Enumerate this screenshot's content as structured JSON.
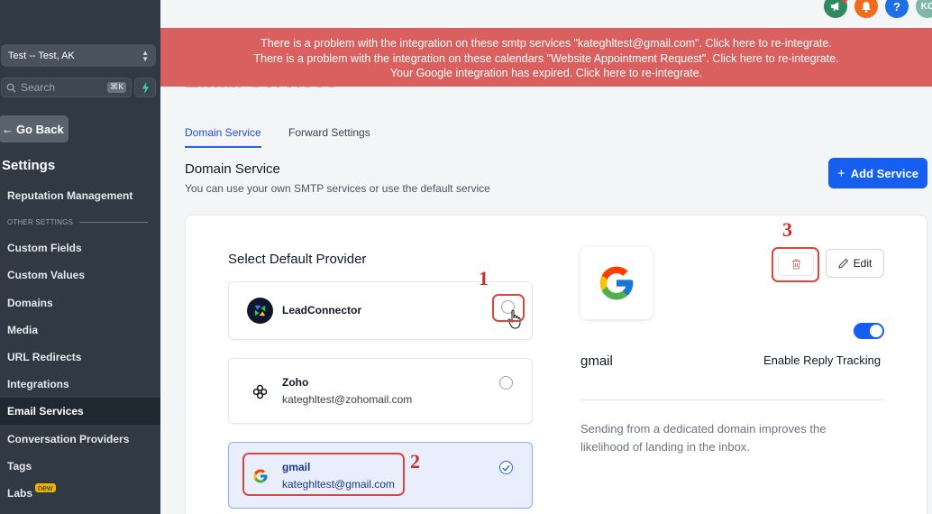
{
  "sidebar": {
    "location": "Test -- Test, AK",
    "search_placeholder": "Search",
    "search_shortcut": "⌘K",
    "back_label": "Go Back",
    "title": "Settings",
    "section_label": "OTHER SETTINGS",
    "items": [
      {
        "label": "Reputation Management"
      },
      {
        "label": "Custom Fields"
      },
      {
        "label": "Custom Values"
      },
      {
        "label": "Domains"
      },
      {
        "label": "Media"
      },
      {
        "label": "URL Redirects"
      },
      {
        "label": "Integrations"
      },
      {
        "label": "Email Services",
        "active": true
      },
      {
        "label": "Conversation Providers"
      },
      {
        "label": "Tags"
      },
      {
        "label": "Labs",
        "badge": "new"
      }
    ]
  },
  "header": {
    "avatar_initials": "KC",
    "help_label": "?"
  },
  "banner": {
    "lines": [
      "There is a problem with the integration on these smtp services \"kateghltest@gmail.com\". Click here to re-integrate.",
      "There is a problem with the integration on these calendars \"Website Appointment Request\". Click here to re-integrate.",
      "Your Google integration has expired. Click here to re-integrate."
    ]
  },
  "page": {
    "heading": "Email Services",
    "tabs": [
      {
        "label": "Domain Service",
        "active": true
      },
      {
        "label": "Forward Settings"
      }
    ],
    "section_title": "Domain Service",
    "section_desc": "You can use your own SMTP services or use the default service",
    "add_button": "Add Service"
  },
  "providers": {
    "title": "Select Default Provider",
    "items": [
      {
        "name": "LeadConnector",
        "email": "",
        "selected": false
      },
      {
        "name": "Zoho",
        "email": "kateghltest@zohomail.com",
        "selected": false
      },
      {
        "name": "gmail",
        "email": "kateghltest@gmail.com",
        "selected": true
      }
    ]
  },
  "details": {
    "service_name": "gmail",
    "edit_label": "Edit",
    "reply_tracking_label": "Enable Reply Tracking",
    "reply_tracking_enabled": true,
    "info": "Sending from a dedicated domain improves the likelihood of landing in the inbox."
  },
  "annotations": [
    "1",
    "2",
    "3"
  ],
  "colors": {
    "sidebar_bg": "#303944",
    "banner_bg": "#d9605e",
    "primary": "#155eef",
    "annotation_red": "#d9473d"
  }
}
